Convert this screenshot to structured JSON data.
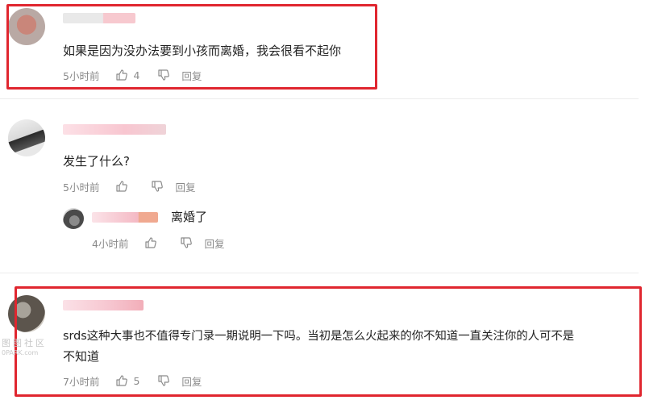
{
  "comments": [
    {
      "text": "如果是因为没办法要到小孩而离婚，我会很看不起你",
      "time": "5小时前",
      "likes": "4",
      "reply_label": "回复"
    },
    {
      "text": "发生了什么?",
      "time": "5小时前",
      "likes": "",
      "reply_label": "回复",
      "replies": [
        {
          "text": "离婚了",
          "time": "4小时前",
          "likes": "",
          "reply_label": "回复"
        }
      ]
    },
    {
      "text_line1": "srds这种大事也不值得专门录一期说明一下吗。当初是怎么火起来的你不知道一直关注你的人可不是",
      "text_line2": "不知道",
      "time": "7小时前",
      "likes": "5",
      "reply_label": "回复"
    }
  ],
  "watermark": {
    "line1": "图图社区",
    "line2": "0PARK.com"
  },
  "colors": {
    "highlight": "#e0262f",
    "meta_text": "#8a8a8a"
  }
}
